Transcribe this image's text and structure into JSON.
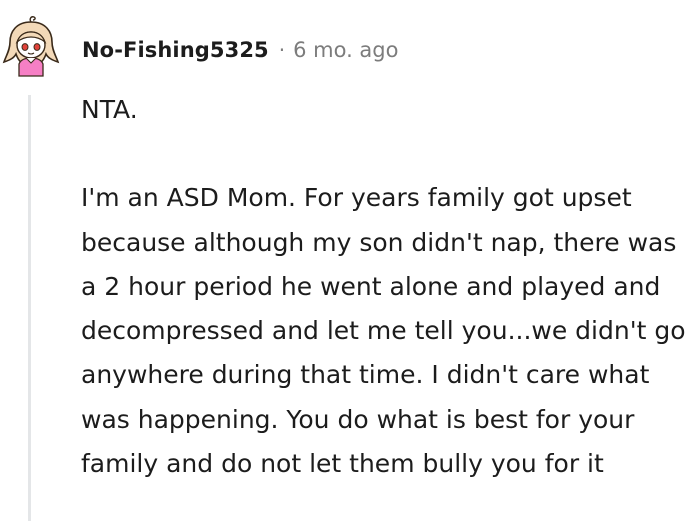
{
  "comment": {
    "username": "No-Fishing5325",
    "separator": "·",
    "age": "6 mo. ago",
    "paragraphs": [
      "NTA.",
      "I'm an ASD Mom. For years family got upset because although my son didn't nap, there was a 2 hour period he went alone and played and decompressed and let me tell you...we didn't go anywhere during that time. I didn't care what was happening. You do what is best for your family and do not let them bully you for it"
    ]
  },
  "colors": {
    "text": "#1c1c1c",
    "meta": "#7c7c7c",
    "thread_line": "#e4e6e8",
    "avatar_hair": "#f3d9b8",
    "avatar_shirt": "#f67fc5"
  },
  "icons": {
    "avatar": "user-avatar-icon"
  }
}
